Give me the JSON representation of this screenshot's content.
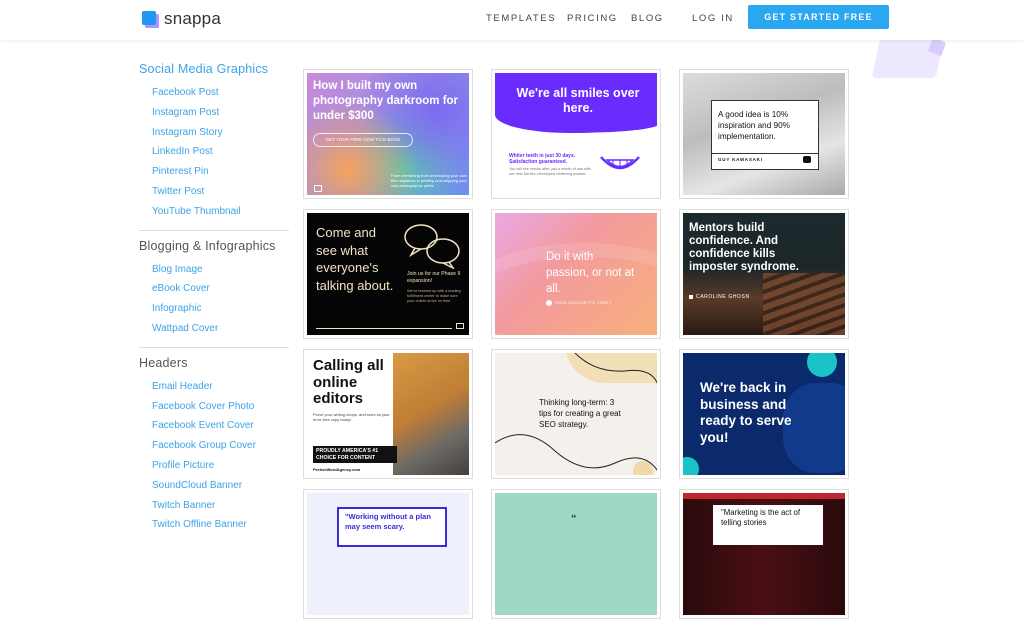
{
  "header": {
    "logo_text": "snappa",
    "nav": [
      "TEMPLATES",
      "PRICING",
      "BLOG"
    ],
    "login": "LOG IN",
    "cta": "GET STARTED FREE"
  },
  "sidebar": {
    "categories": [
      {
        "title": "Social Media Graphics",
        "items": [
          "Facebook Post",
          "Instagram Post",
          "Instagram Story",
          "LinkedIn Post",
          "Pinterest Pin",
          "Twitter Post",
          "YouTube Thumbnail"
        ]
      },
      {
        "title": "Blogging & Infographics",
        "items": [
          "Blog Image",
          "eBook Cover",
          "Infographic",
          "Wattpad Cover"
        ]
      },
      {
        "title": "Headers",
        "items": [
          "Email Header",
          "Facebook Cover Photo",
          "Facebook Event Cover",
          "Facebook Group Cover",
          "Profile Picture",
          "SoundCloud Banner",
          "Twitch Banner",
          "Twitch Offline Banner"
        ]
      }
    ]
  },
  "templates": {
    "t1": {
      "headline": "How I built my own photography darkroom for under $300",
      "button": "GET YOUR FREE HOW TO E-BOOK",
      "caption": "From everything from developing your own film negatives to printing and shipping your own photographic prints"
    },
    "t2": {
      "headline": "We're all smiles over here.",
      "sub": "Whiter teeth in just 30 days. Satisfaction guaranteed.",
      "body": "You will see results after just a month of use with our new Dentico developed whitening powder."
    },
    "t3": {
      "quote": "A good idea is 10% inspiration and 90% implementation.",
      "author": "GUY KAWASAKI"
    },
    "t4": {
      "headline": "Come and see what everyone's talking about.",
      "side": "Join us for our Phase II expansion!",
      "body": "We've teamed up with a leading fulfillment center to make sure your orders arrive on time."
    },
    "t5": {
      "quote": "Do it with passion, or not at all.",
      "author": "ROSA NOUCHETTE CAREY"
    },
    "t6": {
      "quote": "Mentors build confidence. And confidence kills imposter syndrome.",
      "author": "CAROLINE GHOSN"
    },
    "t7": {
      "headline": "Calling all online editors",
      "body": "Prove your writing chops, and send us your error-free copy today!",
      "banner": "PROUDLY AMERICA'S #1 CHOICE FOR CONTENT",
      "site": "PerfectWordAgency.com"
    },
    "t8": {
      "text": "Thinking long-term: 3 tips for creating a great SEO strategy."
    },
    "t9": {
      "headline": "We're back in business and ready to serve you!"
    },
    "t10": {
      "quote": "\"Working without a plan may seem scary."
    },
    "t11": {
      "mark": "“"
    },
    "t12": {
      "quote": "\"Marketing is the act of telling stories"
    }
  },
  "colors": {
    "accent": "#29a8f1",
    "link": "#3ba3e8",
    "purple": "#6a2bff",
    "navy": "#0b2a6b"
  }
}
